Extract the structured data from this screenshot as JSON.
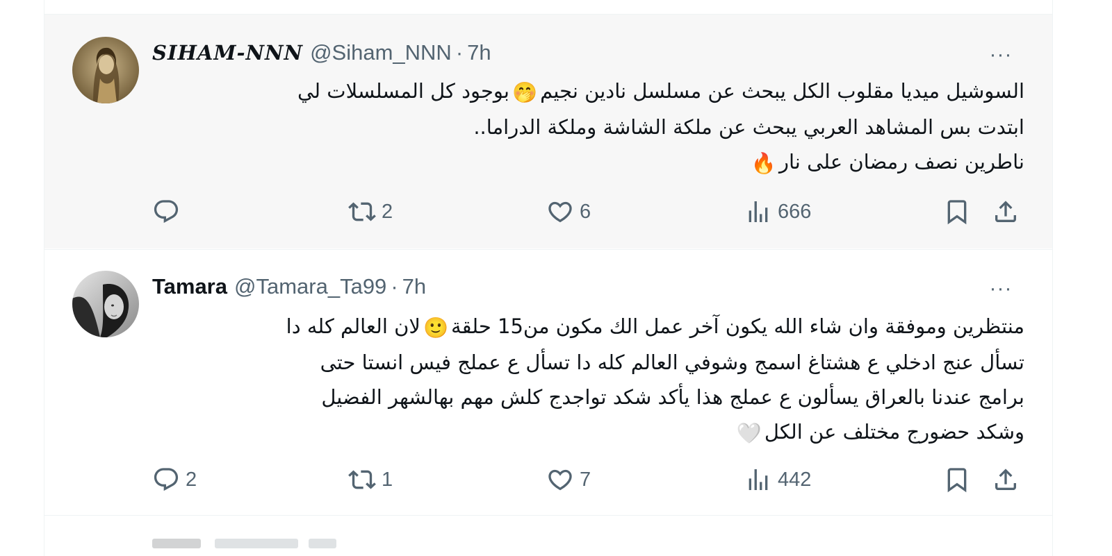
{
  "tweets": [
    {
      "display_name": "SIHAM-NNN",
      "handle": "@Siham_NNN",
      "separator": "·",
      "time": "7h",
      "more_label": "···",
      "lines": [
        {
          "text": "السوشيل ميديا مقلوب الكل يبحث عن مسلسل نادين نجيم",
          "emoji": "🤭",
          "emoji_name": "face-with-hand-over-mouth-emoji",
          "tail": "بوجود كل المسلسلات لي"
        },
        {
          "text": "ابتدت بس المشاهد العربي يبحث عن ملكة الشاشة وملكة الدراما.."
        },
        {
          "text": "ناطرين نصف رمضان على نار",
          "emoji": "🔥",
          "emoji_name": "fire-emoji"
        }
      ],
      "reply_count": "",
      "retweet_count": "2",
      "like_count": "6",
      "view_count": "666"
    },
    {
      "display_name": "Tamara",
      "handle": "@Tamara_Ta99",
      "separator": "·",
      "time": "7h",
      "more_label": "···",
      "lines": [
        {
          "text": "منتظرين وموفقة وان شاء الله يكون آخر عمل الك مكون من15 حلقة",
          "emoji": "🙂",
          "emoji_name": "slightly-smiling-face-emoji",
          "tail": "لان العالم كله دا"
        },
        {
          "text": "تسأل عنج ادخلي ع هشتاغ اسمج وشوفي العالم كله دا تسأل ع عملج فيس انستا حتى"
        },
        {
          "text": "برامج عندنا بالعراق يسألون ع عملج هذا يأكد شكد تواجدج كلش مهم  بهالشهر الفضيل"
        },
        {
          "text": "وشكد حضورج مختلف عن الكل",
          "emoji": "🤍",
          "emoji_name": "white-heart-emoji"
        }
      ],
      "reply_count": "2",
      "retweet_count": "1",
      "like_count": "7",
      "view_count": "442"
    }
  ],
  "icons": {
    "reply": "reply-icon",
    "retweet": "retweet-icon",
    "like": "heart-icon",
    "views": "analytics-icon",
    "bookmark": "bookmark-icon",
    "share": "share-icon",
    "more": "more-icon"
  },
  "colors": {
    "text": "#0f1419",
    "secondary": "#536471",
    "highlight_bg": "#f7f7f7",
    "border": "#eff3f4"
  }
}
